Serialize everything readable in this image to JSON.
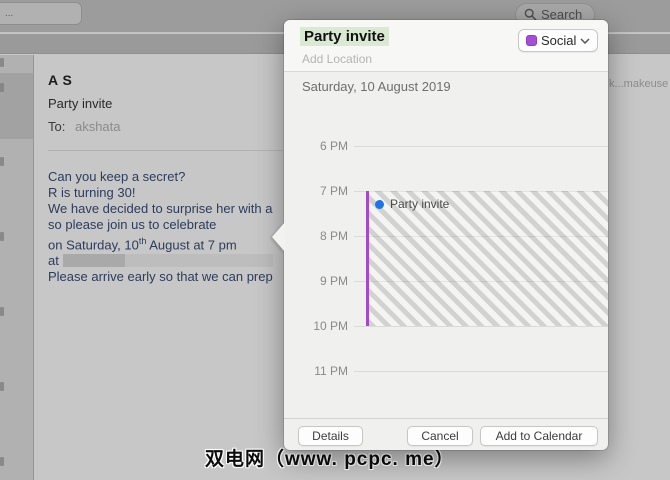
{
  "toolbar": {
    "tab_label": "...",
    "search_placeholder": "Search"
  },
  "background_email": {
    "sender": "A S",
    "subject": "Party invite",
    "to_label": "To:",
    "to_value": "akshata",
    "body_lines": [
      "Can you keep a secret?",
      "R is turning 30!",
      "We have decided to surprise her with a",
      "so please join us to celebrate"
    ],
    "date_line": {
      "pre": "on Saturday, 10",
      "sup": "th",
      "post": " August at 7 pm"
    },
    "at_label": "at",
    "closing_line": "Please arrive early so that we can prep",
    "truncated_link": "k...makeuse"
  },
  "popover": {
    "title": "Party invite",
    "title_highlight_color": "#d9e9d2",
    "location_placeholder": "Add Location",
    "category": {
      "label": "Social",
      "color": "#a24fd4"
    },
    "date_header": "Saturday, 10 August 2019",
    "calendar": {
      "time_labels": [
        "6 PM",
        "7 PM",
        "8 PM",
        "9 PM",
        "10 PM",
        "11 PM"
      ],
      "event": {
        "title": "Party invite",
        "start": "7 PM",
        "end": "10 PM",
        "dot_color": "#1d74e7",
        "border_color": "#a349c9"
      }
    },
    "buttons": {
      "details": "Details",
      "cancel": "Cancel",
      "add_to_calendar": "Add to Calendar"
    }
  },
  "watermark": "双电网（www. pcpc. me）"
}
